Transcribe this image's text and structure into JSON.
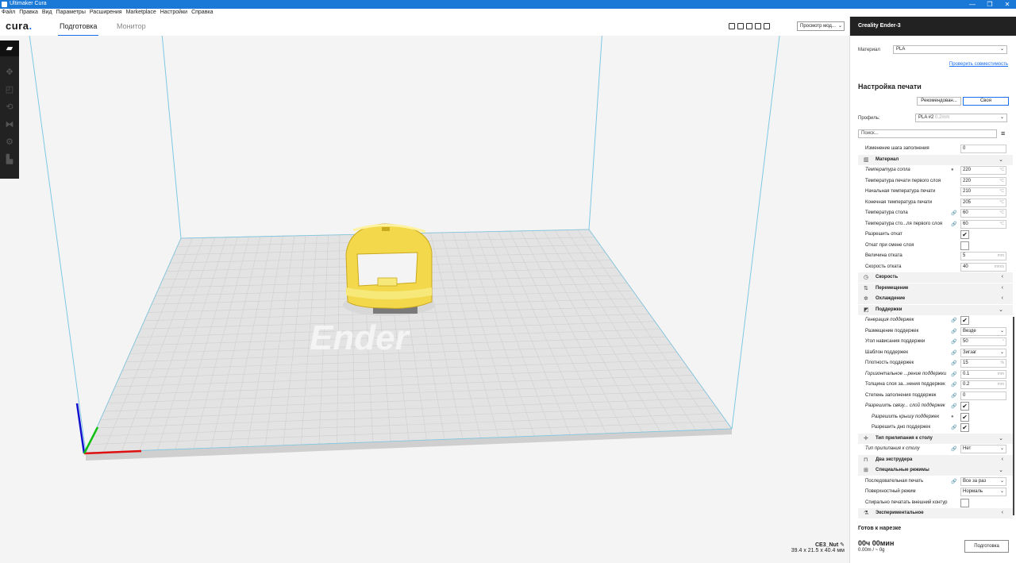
{
  "window": {
    "title": "Ultimaker Cura",
    "controls": [
      "—",
      "❐",
      "✕"
    ]
  },
  "menu": [
    "Файл",
    "Правка",
    "Вид",
    "Параметры",
    "Расширения",
    "Marketplace",
    "Настройки",
    "Справка"
  ],
  "header": {
    "logo_main": "cura",
    "logo_dot": ".",
    "tab_prepare": "Подготовка",
    "tab_monitor": "Монитор",
    "view_mode": "Просмотр мод..."
  },
  "object": {
    "name": "CE3_Nut",
    "dims": "39.4 x 21.5 x 40.4 мм"
  },
  "bed_logo": "Ender",
  "panel": {
    "printer": "Creality Ender-3",
    "material_label": "Материал",
    "material_value": "PLA",
    "compat_link": "Проверить совместимость",
    "print_setup_title": "Настройка печати",
    "mode_recommended": "Рекомендован...",
    "mode_custom": "Своя",
    "profile_label": "Профиль:",
    "profile_value": "PLA #2",
    "profile_hint": "0.2mm",
    "search_placeholder": "Поиск...",
    "menu_icon": "≡"
  },
  "settings": [
    {
      "kind": "row",
      "name": "Изменение шага заполнения",
      "value": "0",
      "unit": ""
    },
    {
      "kind": "cat",
      "name": "Материал",
      "icon": "material-icon",
      "glyph": "▥",
      "state": "open"
    },
    {
      "kind": "row",
      "name": "Температура сопла",
      "value": "220",
      "unit": "°C",
      "italic": true,
      "icon": "●"
    },
    {
      "kind": "row",
      "name": "Температура печати первого слоя",
      "value": "220",
      "unit": "°C"
    },
    {
      "kind": "row",
      "name": "Начальная температура печати",
      "value": "210",
      "unit": "°C"
    },
    {
      "kind": "row",
      "name": "Конечная температура печати",
      "value": "205",
      "unit": "°C"
    },
    {
      "kind": "row",
      "name": "Температура стола",
      "value": "60",
      "unit": "°C",
      "icon": "🔗"
    },
    {
      "kind": "row",
      "name": "Температура сто...ля первого слоя",
      "value": "60",
      "unit": "°C",
      "icon": "🔗"
    },
    {
      "kind": "check",
      "name": "Разрешить откат",
      "checked": "✔"
    },
    {
      "kind": "check",
      "name": "Откат при смене слоя",
      "checked": ""
    },
    {
      "kind": "row",
      "name": "Величина отката",
      "value": "5",
      "unit": "mm"
    },
    {
      "kind": "row",
      "name": "Скорость отката",
      "value": "40",
      "unit": "mm/s"
    },
    {
      "kind": "cat",
      "name": "Скорость",
      "icon": "speed-icon",
      "glyph": "◷",
      "state": "closed"
    },
    {
      "kind": "cat",
      "name": "Перемещение",
      "icon": "travel-icon",
      "glyph": "⇅",
      "state": "closed"
    },
    {
      "kind": "cat",
      "name": "Охлаждение",
      "icon": "fan-icon",
      "glyph": "✲",
      "state": "closed"
    },
    {
      "kind": "cat",
      "name": "Поддержки",
      "icon": "support-icon",
      "glyph": "◩",
      "state": "open"
    },
    {
      "kind": "check",
      "name": "Генерация поддержек",
      "checked": "✔",
      "italic": true,
      "icon": "🔗"
    },
    {
      "kind": "select",
      "name": "Размещение поддержек",
      "value": "Везде",
      "icon": "🔗"
    },
    {
      "kind": "row",
      "name": "Угол нависания поддержки",
      "value": "50",
      "unit": "°",
      "icon": "🔗"
    },
    {
      "kind": "select",
      "name": "Шаблон поддержек",
      "value": "Зигзаг",
      "icon": "🔗"
    },
    {
      "kind": "row",
      "name": "Плотность поддержек",
      "value": "15",
      "unit": "%",
      "icon": "🔗"
    },
    {
      "kind": "row",
      "name": "Горизонтальное ...рение поддержки",
      "value": "0.1",
      "unit": "mm",
      "italic": true,
      "icon": "🔗"
    },
    {
      "kind": "row",
      "name": "Толщина слоя за...нения поддержек",
      "value": "0.2",
      "unit": "mm",
      "icon": "🔗"
    },
    {
      "kind": "row",
      "name": "Степень заполнения поддержек",
      "value": "0",
      "unit": "",
      "icon": "🔗"
    },
    {
      "kind": "check",
      "name": "Разрешить связу... слой поддержек",
      "checked": "✔",
      "italic": true,
      "icon": "🔗"
    },
    {
      "kind": "check",
      "name": "Разрешить крышу поддержек",
      "checked": "✔",
      "italic": true,
      "indent": true,
      "icon": "●"
    },
    {
      "kind": "check",
      "name": "Разрешить дно поддержек",
      "checked": "✔",
      "indent": true,
      "icon": "🔗"
    },
    {
      "kind": "cat",
      "name": "Тип прилипания к столу",
      "icon": "adhesion-icon",
      "glyph": "✛",
      "state": "open"
    },
    {
      "kind": "select",
      "name": "Тип прилипания к столу",
      "value": "Нет",
      "italic": true,
      "icon": "🔗"
    },
    {
      "kind": "cat",
      "name": "Два экструдера",
      "icon": "dual-extruder-icon",
      "glyph": "⊓",
      "state": "closed"
    },
    {
      "kind": "cat",
      "name": "Специальные режимы",
      "icon": "special-icon",
      "glyph": "⊞",
      "state": "open"
    },
    {
      "kind": "select",
      "name": "Последовательная печать",
      "value": "Все за раз",
      "icon": "🔗"
    },
    {
      "kind": "select",
      "name": "Поверхностный режим",
      "value": "Нормаль",
      "icon": ""
    },
    {
      "kind": "check",
      "name": "Спирально печатать внешний контур",
      "checked": ""
    },
    {
      "kind": "cat",
      "name": "Экспериментальное",
      "icon": "flask-icon",
      "glyph": "⚗",
      "state": "closed"
    }
  ],
  "footer": {
    "status": "Готов к нарезке",
    "time": "00ч 00мин",
    "material": "0.00m / ~ 0g",
    "slice_button": "Подготовка"
  }
}
